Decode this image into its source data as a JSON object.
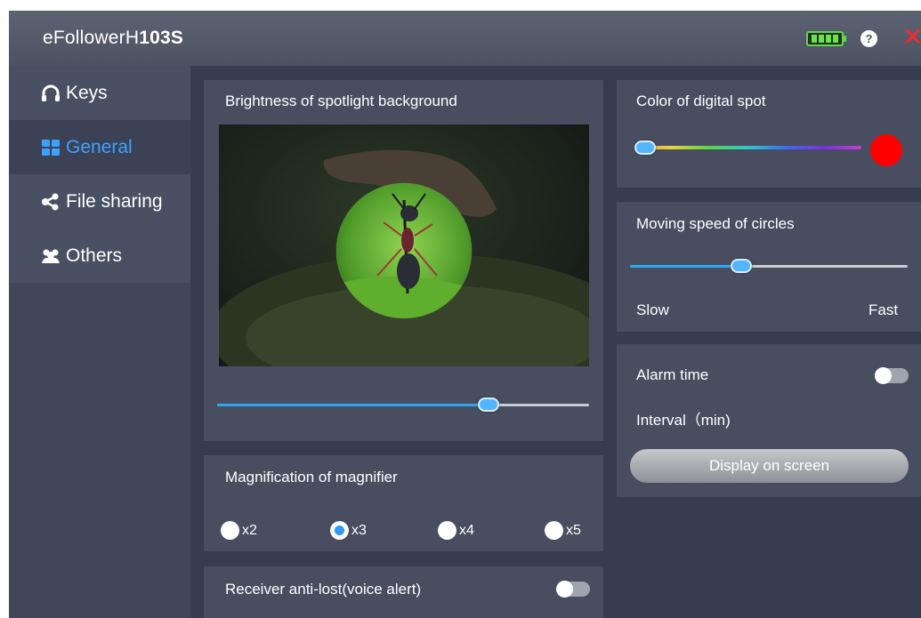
{
  "app": {
    "title_prefix": "eFollowerH",
    "title_bold": "103S",
    "battery_icon": "battery-full-icon",
    "help_label": "?",
    "close_label": "✕"
  },
  "sidebar": {
    "items": [
      {
        "label": "Keys",
        "icon": "headphones-icon",
        "active": false
      },
      {
        "label": "General",
        "icon": "grid-icon",
        "active": true
      },
      {
        "label": "File sharing",
        "icon": "share-icon",
        "active": false
      },
      {
        "label": "Others",
        "icon": "people-icon",
        "active": false
      }
    ]
  },
  "brightness": {
    "label": "Brightness of spotlight background",
    "value_fraction": 0.73
  },
  "magnifier": {
    "label": "Magnification of magnifier",
    "options": [
      "x2",
      "x3",
      "x4",
      "x5"
    ],
    "selected": "x3"
  },
  "anti_lost": {
    "label": "Receiver anti-lost(voice alert)",
    "enabled": false
  },
  "spot_color": {
    "label": "Color of digital spot",
    "value_fraction": 0.0,
    "swatch": "#ff0000"
  },
  "speed": {
    "label": "Moving speed of circles",
    "min_label": "Slow",
    "max_label": "Fast",
    "value_fraction": 0.4
  },
  "alarm": {
    "label": "Alarm time",
    "enabled": false,
    "interval_label": "Interval（min)",
    "display_button": "Display on screen"
  },
  "colors": {
    "accent": "#3ba3ff",
    "window_bg": "#373d4f",
    "panel_bg": "#484e60",
    "close": "#ff2626",
    "battery": "#5fd84a"
  }
}
